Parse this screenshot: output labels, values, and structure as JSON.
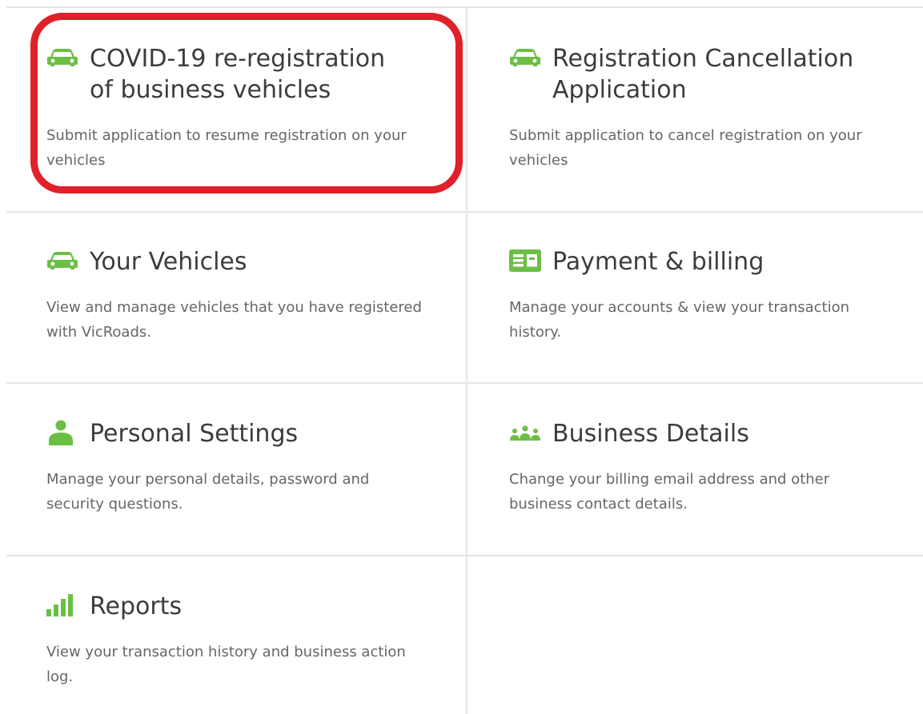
{
  "colors": {
    "accent_green": "#6cbf45",
    "highlight_red": "#e0202a",
    "divider": "#e6e6e6",
    "title_text": "#3c3c3c",
    "desc_text": "#666666"
  },
  "tiles": [
    {
      "icon": "car-icon",
      "title": "COVID-19 re-registration\nof business vehicles",
      "description": "Submit application to resume registration on your vehicles"
    },
    {
      "icon": "car-icon",
      "title": "Registration Cancellation\nApplication",
      "description": "Submit application to cancel registration on your vehicles"
    },
    {
      "icon": "car-icon",
      "title": "Your Vehicles",
      "description": "View and manage vehicles that you have registered with VicRoads."
    },
    {
      "icon": "billing-card-icon",
      "title": "Payment & billing",
      "description": "Manage your accounts & view your transaction history."
    },
    {
      "icon": "person-icon",
      "title": "Personal Settings",
      "description": "Manage your personal details, password and security questions."
    },
    {
      "icon": "group-icon",
      "title": "Business Details",
      "description": "Change your billing email address and other business contact details."
    },
    {
      "icon": "bar-chart-icon",
      "title": "Reports",
      "description": "View your transaction history and business action log."
    }
  ]
}
